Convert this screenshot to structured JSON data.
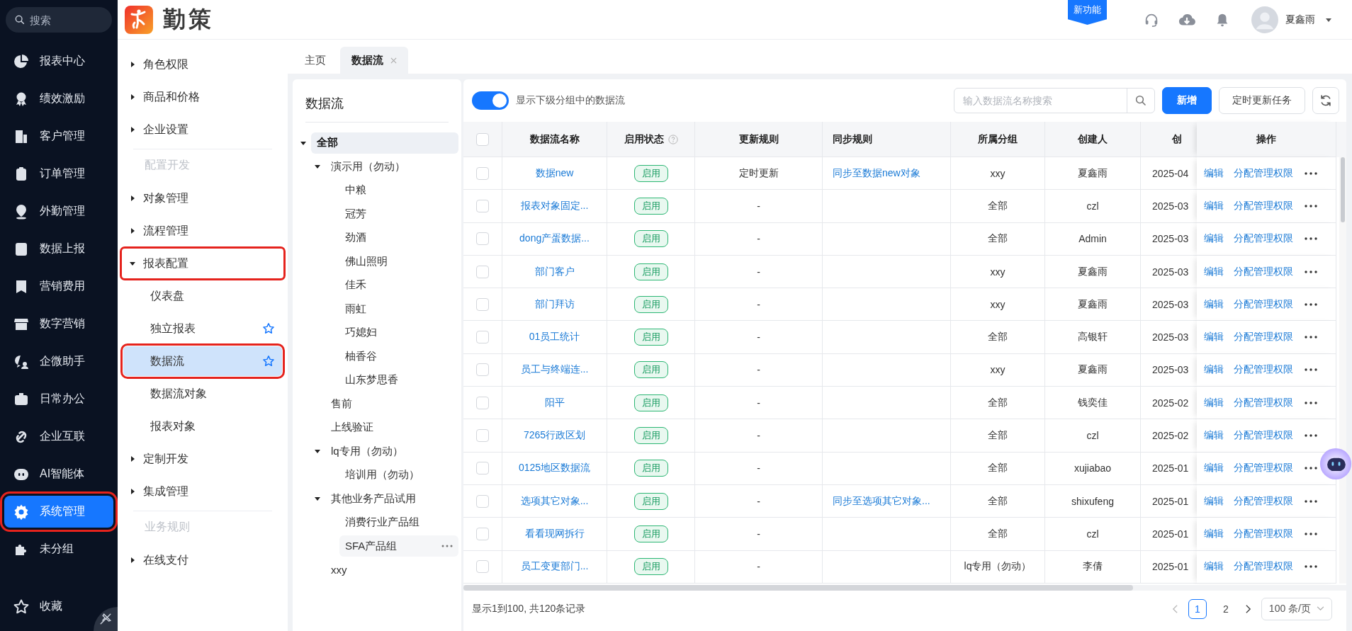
{
  "nav": {
    "search": {
      "placeholder": "搜索"
    },
    "items": [
      {
        "label": "报表中心",
        "selected": false,
        "marked": false
      },
      {
        "label": "绩效激励",
        "selected": false,
        "marked": false
      },
      {
        "label": "客户管理",
        "selected": false,
        "marked": false
      },
      {
        "label": "订单管理",
        "selected": false,
        "marked": false
      },
      {
        "label": "外勤管理",
        "selected": false,
        "marked": false
      },
      {
        "label": "数据上报",
        "selected": false,
        "marked": false
      },
      {
        "label": "营销费用",
        "selected": false,
        "marked": false
      },
      {
        "label": "数字营销",
        "selected": false,
        "marked": false
      },
      {
        "label": "企微助手",
        "selected": false,
        "marked": false
      },
      {
        "label": "日常办公",
        "selected": false,
        "marked": false
      },
      {
        "label": "企业互联",
        "selected": false,
        "marked": false
      },
      {
        "label": "AI智能体",
        "selected": false,
        "marked": false
      },
      {
        "label": "系统管理",
        "selected": true,
        "marked": true
      },
      {
        "label": "未分组",
        "selected": false,
        "marked": false
      }
    ],
    "favorites": "收藏"
  },
  "header": {
    "brand": "勤策",
    "new_feature_badge": "新功能",
    "user": "夏鑫雨"
  },
  "menu": [
    {
      "kind": "group",
      "label": "角色权限",
      "expanded": false,
      "marked": false
    },
    {
      "kind": "group",
      "label": "商品和价格",
      "expanded": false,
      "marked": false
    },
    {
      "kind": "group",
      "label": "企业设置",
      "expanded": false,
      "marked": false
    },
    {
      "kind": "section",
      "label": "配置开发"
    },
    {
      "kind": "group",
      "label": "对象管理",
      "expanded": false,
      "marked": false
    },
    {
      "kind": "group",
      "label": "流程管理",
      "expanded": false,
      "marked": false
    },
    {
      "kind": "group",
      "label": "报表配置",
      "expanded": true,
      "marked": true,
      "children": [
        {
          "label": "仪表盘",
          "favorite": false,
          "selected": false,
          "marked": false
        },
        {
          "label": "独立报表",
          "favorite": true,
          "selected": false,
          "marked": false
        },
        {
          "label": "数据流",
          "favorite": true,
          "selected": true,
          "marked": true
        },
        {
          "label": "数据流对象",
          "favorite": false,
          "selected": false,
          "marked": false
        },
        {
          "label": "报表对象",
          "favorite": false,
          "selected": false,
          "marked": false
        }
      ]
    },
    {
      "kind": "group",
      "label": "定制开发",
      "expanded": false,
      "marked": false
    },
    {
      "kind": "group",
      "label": "集成管理",
      "expanded": false,
      "marked": false
    },
    {
      "kind": "section",
      "label": "业务规则"
    },
    {
      "kind": "group",
      "label": "在线支付",
      "expanded": false,
      "marked": false
    }
  ],
  "tabs": [
    {
      "label": "主页",
      "selected": false,
      "closable": false
    },
    {
      "label": "数据流",
      "selected": true,
      "closable": true
    }
  ],
  "tree": {
    "title": "数据流",
    "nodes": [
      {
        "label": "全部",
        "expanded": true,
        "selected": true,
        "hovered": false,
        "children": [
          {
            "label": "演示用（勿动）",
            "expanded": true,
            "selected": false,
            "hovered": false,
            "children": [
              {
                "label": "中粮",
                "selected": false,
                "hovered": false
              },
              {
                "label": "冠芳",
                "selected": false,
                "hovered": false
              },
              {
                "label": "劲酒",
                "selected": false,
                "hovered": false
              },
              {
                "label": "佛山照明",
                "selected": false,
                "hovered": false
              },
              {
                "label": "佳禾",
                "selected": false,
                "hovered": false
              },
              {
                "label": "雨虹",
                "selected": false,
                "hovered": false
              },
              {
                "label": "巧媳妇",
                "selected": false,
                "hovered": false
              },
              {
                "label": "柚香谷",
                "selected": false,
                "hovered": false
              },
              {
                "label": "山东梦思香",
                "selected": false,
                "hovered": false
              }
            ]
          },
          {
            "label": "售前",
            "selected": false,
            "hovered": false
          },
          {
            "label": "上线验证",
            "selected": false,
            "hovered": false
          },
          {
            "label": "lq专用（勿动）",
            "expanded": true,
            "selected": false,
            "hovered": false,
            "children": [
              {
                "label": "培训用（勿动）",
                "selected": false,
                "hovered": false
              }
            ]
          },
          {
            "label": "其他业务产品试用",
            "expanded": true,
            "selected": false,
            "hovered": false,
            "children": [
              {
                "label": "消费行业产品组",
                "selected": false,
                "hovered": false
              },
              {
                "label": "SFA产品组",
                "selected": false,
                "hovered": true
              }
            ]
          },
          {
            "label": "xxy",
            "selected": false,
            "hovered": false
          }
        ]
      }
    ]
  },
  "toolbar": {
    "toggle": {
      "label": "显示下级分组中的数据流",
      "on": true
    },
    "search": {
      "placeholder": "输入数据流名称搜索"
    },
    "buttons": [
      "新增",
      "定时更新任务"
    ]
  },
  "table": {
    "select_all": {
      "checked": false
    },
    "columns": [
      "数据流名称",
      "启用状态",
      "更新规则",
      "同步规则",
      "所属分组",
      "创建人",
      "创",
      "操作"
    ],
    "rows": [
      {
        "checked": false,
        "name": "数据new",
        "status": "启用",
        "update": "定时更新",
        "sync": "同步至数据new对象",
        "group": "xxy",
        "creator": "夏鑫雨",
        "created": "2025-04",
        "actions": [
          "编辑",
          "分配管理权限"
        ]
      },
      {
        "checked": false,
        "name": "报表对象固定...",
        "status": "启用",
        "update": "-",
        "group": "全部",
        "creator": "czl",
        "created": "2025-03",
        "actions": [
          "编辑",
          "分配管理权限"
        ]
      },
      {
        "checked": false,
        "name": "dong产蛋数据...",
        "status": "启用",
        "update": "-",
        "group": "全部",
        "creator": "Admin",
        "created": "2025-03",
        "actions": [
          "编辑",
          "分配管理权限"
        ]
      },
      {
        "checked": false,
        "name": "部门客户",
        "status": "启用",
        "update": "-",
        "group": "xxy",
        "creator": "夏鑫雨",
        "created": "2025-03",
        "actions": [
          "编辑",
          "分配管理权限"
        ]
      },
      {
        "checked": false,
        "name": "部门拜访",
        "status": "启用",
        "update": "-",
        "group": "xxy",
        "creator": "夏鑫雨",
        "created": "2025-03",
        "actions": [
          "编辑",
          "分配管理权限"
        ]
      },
      {
        "checked": false,
        "name": "01员工统计",
        "status": "启用",
        "update": "-",
        "group": "全部",
        "creator": "高银轩",
        "created": "2025-03",
        "actions": [
          "编辑",
          "分配管理权限"
        ]
      },
      {
        "checked": false,
        "name": "员工与终端连...",
        "status": "启用",
        "update": "-",
        "group": "xxy",
        "creator": "夏鑫雨",
        "created": "2025-03",
        "actions": [
          "编辑",
          "分配管理权限"
        ]
      },
      {
        "checked": false,
        "name": "阳平",
        "status": "启用",
        "update": "-",
        "group": "全部",
        "creator": "钱奕佳",
        "created": "2025-02",
        "actions": [
          "编辑",
          "分配管理权限"
        ]
      },
      {
        "checked": false,
        "name": "7265行政区划",
        "status": "启用",
        "update": "-",
        "group": "全部",
        "creator": "czl",
        "created": "2025-02",
        "actions": [
          "编辑",
          "分配管理权限"
        ]
      },
      {
        "checked": false,
        "name": "0125地区数据流",
        "status": "启用",
        "update": "-",
        "group": "全部",
        "creator": "xujiabao",
        "created": "2025-01",
        "actions": [
          "编辑",
          "分配管理权限"
        ]
      },
      {
        "checked": false,
        "name": "选项其它对象...",
        "status": "启用",
        "update": "-",
        "sync": "同步至选项其它对象...",
        "group": "全部",
        "creator": "shixufeng",
        "created": "2025-01",
        "actions": [
          "编辑",
          "分配管理权限"
        ]
      },
      {
        "checked": false,
        "name": "看看现网拆行",
        "status": "启用",
        "update": "-",
        "group": "全部",
        "creator": "czl",
        "created": "2025-01",
        "actions": [
          "编辑",
          "分配管理权限"
        ]
      },
      {
        "checked": false,
        "name": "员工变更部门...",
        "status": "启用",
        "update": "-",
        "group": "lq专用（勿动）",
        "creator": "李倩",
        "created": "2025-01",
        "actions": [
          "编辑",
          "分配管理权限"
        ]
      }
    ]
  },
  "footer": {
    "summary": "显示1到100, 共120条记录",
    "pages": [
      {
        "label": "1",
        "selected": true
      },
      {
        "label": "2",
        "selected": false
      }
    ],
    "page_size": "100 条/页"
  }
}
